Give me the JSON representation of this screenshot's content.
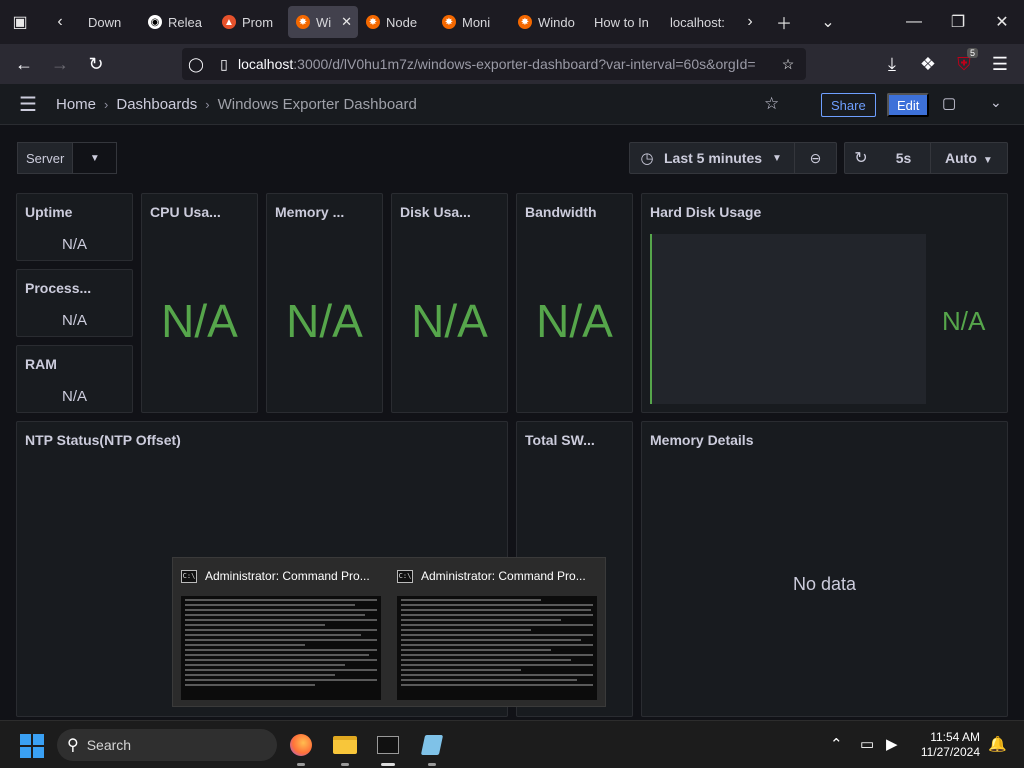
{
  "browser": {
    "tabs": [
      {
        "label": "Down",
        "icon": "download-icon"
      },
      {
        "label": "Relea",
        "icon": "github-icon"
      },
      {
        "label": "Prom",
        "icon": "prometheus-icon"
      },
      {
        "label": "Wi",
        "icon": "grafana-icon",
        "active": true
      },
      {
        "label": "Node",
        "icon": "grafana-icon"
      },
      {
        "label": "Moni",
        "icon": "grafana-icon"
      },
      {
        "label": "Windo",
        "icon": "grafana-icon"
      },
      {
        "label": "How to In",
        "icon": ""
      },
      {
        "label": "localhost:",
        "icon": ""
      }
    ],
    "url_host": "localhost",
    "url_rest": ":3000/d/lV0hu1m7z/windows-exporter-dashboard?var-interval=60s&orgId=",
    "extension_badge": "5"
  },
  "grafana": {
    "breadcrumb": {
      "home": "Home",
      "dashboards": "Dashboards",
      "current": "Windows Exporter Dashboard"
    },
    "share_label": "Share",
    "edit_label": "Edit",
    "variable_label": "Server",
    "time_range": "Last 5 minutes",
    "refresh_interval": "5s",
    "auto_label": "Auto"
  },
  "panels": {
    "uptime": {
      "title": "Uptime",
      "value": "N/A"
    },
    "processes": {
      "title": "Process...",
      "value": "N/A"
    },
    "ram": {
      "title": "RAM",
      "value": "N/A"
    },
    "cpu": {
      "title": "CPU Usa...",
      "value": "N/A"
    },
    "memory": {
      "title": "Memory ...",
      "value": "N/A"
    },
    "disk": {
      "title": "Disk Usa...",
      "value": "N/A"
    },
    "bandwidth": {
      "title": "Bandwidth",
      "value": "N/A"
    },
    "hard_disk": {
      "title": "Hard Disk Usage",
      "value": "N/A"
    },
    "ntp": {
      "title": "NTP Status(NTP Offset)"
    },
    "total_sw": {
      "title": "Total SW..."
    },
    "memory_details": {
      "title": "Memory Details",
      "message": "No data"
    }
  },
  "taskbar_preview": {
    "window1_title": "Administrator: Command Pro...",
    "window2_title": "Administrator: Command Pro..."
  },
  "taskbar": {
    "search_label": "Search",
    "time": "11:54 AM",
    "date": "11/27/2024"
  },
  "colors": {
    "accent_green": "#56a64b",
    "grafana_blue": "#3d71d9",
    "share_blue": "#6e9fff",
    "windows_blue": "#3aa0f3"
  }
}
